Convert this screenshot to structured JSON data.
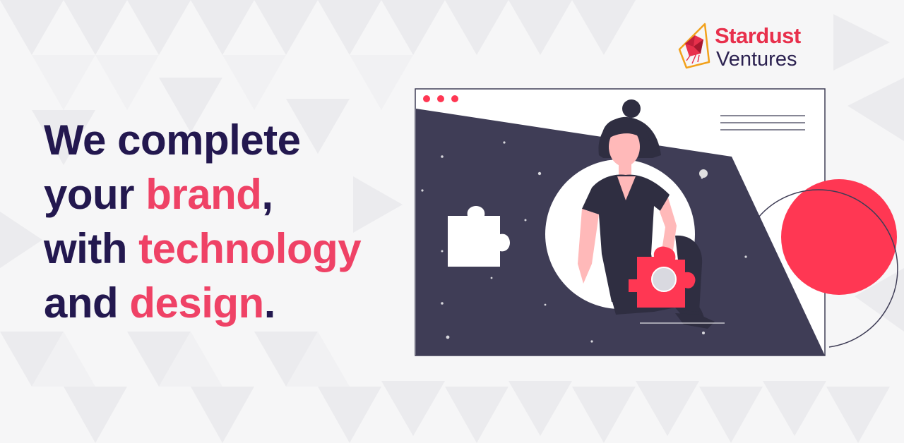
{
  "brand": {
    "name_primary": "Stardust",
    "name_secondary": "Ventures",
    "logo_icon": "crystal-gem-icon",
    "primary_color": "#e8304c",
    "text_color": "#2b2150"
  },
  "headline": {
    "line1": "We complete",
    "line2_prefix": "your ",
    "line2_highlight": "brand",
    "line2_suffix": ",",
    "line3_prefix": "with ",
    "line3_highlight": "technology",
    "line4_prefix": "and ",
    "line4_highlight": "design",
    "line4_suffix": ".",
    "base_color": "#23184f",
    "highlight_color": "#ef4266"
  },
  "illustration": {
    "subject": "woman-holding-puzzle-piece",
    "window_dots": 3,
    "panel_color": "#3f3d56",
    "accent_circle_color": "#ff3753"
  }
}
